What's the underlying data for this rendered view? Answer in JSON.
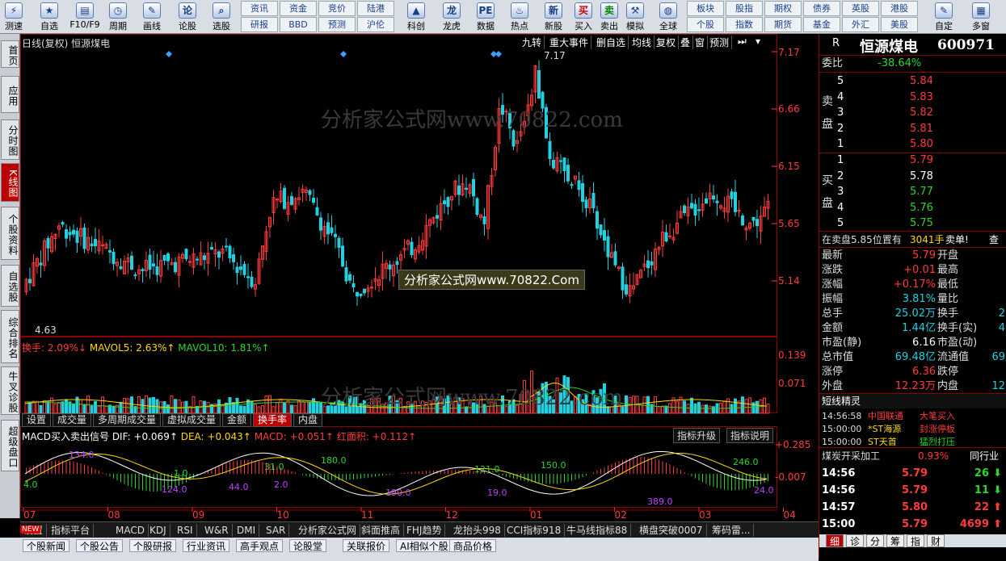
{
  "toolbar": {
    "big": [
      {
        "label": "测速",
        "icon": "speed"
      },
      {
        "label": "自选",
        "icon": "star"
      },
      {
        "label": "F10/F9",
        "icon": "f10"
      },
      {
        "label": "周期",
        "icon": "clock"
      },
      {
        "label": "画线",
        "icon": "pen"
      },
      {
        "label": "论股",
        "icon": "chat"
      },
      {
        "label": "选股",
        "icon": "search"
      }
    ],
    "small_top": [
      "资讯",
      "资金",
      "竞价",
      "陆港"
    ],
    "small_bot": [
      "研报",
      "BBD",
      "预测",
      "沪伦"
    ],
    "big2": [
      {
        "label": "科创"
      },
      {
        "label": "龙虎"
      },
      {
        "label": "数据"
      },
      {
        "label": "热点"
      },
      {
        "label": "新股"
      }
    ],
    "buy": "买入",
    "sell": "卖出",
    "sim": "模拟",
    "global": "全球",
    "small3_top": [
      "板块",
      "股指",
      "期权",
      "债券",
      "英股",
      "港股"
    ],
    "small3_bot": [
      "个股",
      "指数",
      "期货",
      "基金",
      "外汇",
      "美股"
    ],
    "custom": "自定",
    "multi": "多窗"
  },
  "left_tabs": [
    "首页",
    "应用",
    "分时图",
    "K线图",
    "个股资料",
    "自选股",
    "综合排名",
    "牛叉诊股",
    "超级盘口"
  ],
  "chart": {
    "title_left": "日线(复权)  恒源煤电",
    "menu": [
      "九转",
      "重大事件",
      "删自选",
      "均线",
      "复权",
      "叠",
      "窗",
      "预测"
    ],
    "watermark": "分析家公式网www.70822.com",
    "watermark2": "分析家公式网www.70822.Com",
    "high_label": "7.17",
    "low_label": "4.63",
    "price_ticks": [
      "7.17",
      "6.66",
      "6.15",
      "5.65",
      "5.14"
    ],
    "vol_ticks": [
      "0.139",
      "0.071"
    ],
    "macd_ticks": [
      "+0.285",
      "-0.007"
    ],
    "vol_info": {
      "a": "换手: 2.09%↓",
      "b": "MAVOL5: 2.63%↑",
      "c": "MAVOL10: 1.81%↑"
    },
    "ind_tabs": [
      "设置",
      "成交量",
      "多周期成交量",
      "虚拟成交量",
      "金额",
      "换手率",
      "内盘"
    ],
    "ind_right": [
      "指标升级",
      "指标说明"
    ],
    "macd_info": {
      "a": "MACD买入卖出信号",
      "b": "DIF: +0.069↑",
      "c": "DEA: +0.043↑",
      "d": "MACD: +0.051↑",
      "e": "红面积: +0.112↑"
    },
    "macd_labels": [
      "134.0",
      "4.0",
      "124.0",
      "1.0",
      "44.0",
      "31.0",
      "2.0",
      "180.0",
      "190.0",
      "121.0",
      "19.0",
      "150.0",
      "389.0",
      "246.0",
      "24.0"
    ],
    "months": [
      "07",
      "08",
      "09",
      "10",
      "11",
      "12",
      "01",
      "02",
      "03",
      "04"
    ]
  },
  "right": {
    "code_prefix": "R",
    "name": "恒源煤电",
    "code": "600971",
    "weibi_label": "委比",
    "weibi": "-38.64%",
    "sell_label": "卖盘",
    "buy_label": "买盘",
    "sells": [
      {
        "n": "5",
        "p": "5.84"
      },
      {
        "n": "4",
        "p": "5.83"
      },
      {
        "n": "3",
        "p": "5.82"
      },
      {
        "n": "2",
        "p": "5.81"
      },
      {
        "n": "1",
        "p": "5.80"
      }
    ],
    "buys": [
      {
        "n": "1",
        "p": "5.79"
      },
      {
        "n": "2",
        "p": "5.78"
      },
      {
        "n": "3",
        "p": "5.77"
      },
      {
        "n": "4",
        "p": "5.76"
      },
      {
        "n": "5",
        "p": "5.75"
      }
    ],
    "notice": "在卖盘5.85位置有",
    "notice_v": "3041手",
    "notice_s": "卖单!",
    "notice_btn": "查",
    "stats_l": [
      {
        "k": "最新",
        "v": "5.79",
        "c": "red"
      },
      {
        "k": "涨跌",
        "v": "+0.01",
        "c": "red"
      },
      {
        "k": "涨幅",
        "v": "+0.17%",
        "c": "red"
      },
      {
        "k": "振幅",
        "v": "3.81%",
        "c": "cyn"
      },
      {
        "k": "总手",
        "v": "25.02万",
        "c": "cyn"
      },
      {
        "k": "金额",
        "v": "1.44亿",
        "c": "cyn"
      },
      {
        "k": "市盈(静)",
        "v": "6.16",
        "c": "wht"
      },
      {
        "k": "总市值",
        "v": "69.48亿",
        "c": "cyn"
      },
      {
        "k": "涨停",
        "v": "6.36",
        "c": "red"
      },
      {
        "k": "外盘",
        "v": "12.23万",
        "c": "red"
      }
    ],
    "stats_r": [
      {
        "k": "开盘",
        "v": ""
      },
      {
        "k": "最高",
        "v": ""
      },
      {
        "k": "最低",
        "v": ""
      },
      {
        "k": "量比",
        "v": ""
      },
      {
        "k": "换手",
        "v": "2"
      },
      {
        "k": "换手(实)",
        "v": "4"
      },
      {
        "k": "市盈(动)",
        "v": ""
      },
      {
        "k": "流通值",
        "v": "69"
      },
      {
        "k": "跌停",
        "v": ""
      },
      {
        "k": "内盘",
        "v": "12"
      }
    ],
    "jl_title": "短线精灵",
    "jl": [
      {
        "t": "14:56:58",
        "n": "中国联通",
        "e": "大笔买入"
      },
      {
        "t": "15:00:00",
        "n": "*ST海源",
        "e": "封涨停板"
      },
      {
        "t": "15:00:00",
        "n": "ST天首",
        "e": "猛烈打压"
      }
    ],
    "sector": "煤炭开采加工",
    "sector_v": "0.93%",
    "sector_btn": "同行业",
    "ticks": [
      {
        "t": "14:56",
        "p": "5.79",
        "v": "26",
        "d": "dn"
      },
      {
        "t": "14:56",
        "p": "5.79",
        "v": "11",
        "d": "dn"
      },
      {
        "t": "14:57",
        "p": "5.80",
        "v": "22",
        "d": "up"
      },
      {
        "t": "15:00",
        "p": "5.79",
        "v": "4699",
        "d": "up"
      }
    ],
    "tabs": [
      "细",
      "诊",
      "分",
      "筹",
      "指",
      "财"
    ]
  },
  "bottom_tabs": [
    "设置",
    "指标平台",
    "MACD",
    "KDJ",
    "RSI",
    "W&R",
    "DMI",
    "SAR",
    "分析家公式网",
    "斜面推高",
    "FHJ趋势",
    "龙抬头998",
    "CCI指标918",
    "牛马线指标88",
    "横盘突破0007",
    "筹码雷..."
  ],
  "bottom2_tabs": [
    "个股新闻",
    "个股公告",
    "个股研报",
    "行业资讯",
    "高手观点",
    "论股堂",
    "关联报价",
    "AI相似个股",
    "商品价格"
  ],
  "new_badge": "NEW",
  "colors": {
    "up": "#ff3b3b",
    "down": "#22d0e0",
    "yellow": "#ffd800",
    "grid": "#8b0000",
    "purple": "#c040ff"
  }
}
